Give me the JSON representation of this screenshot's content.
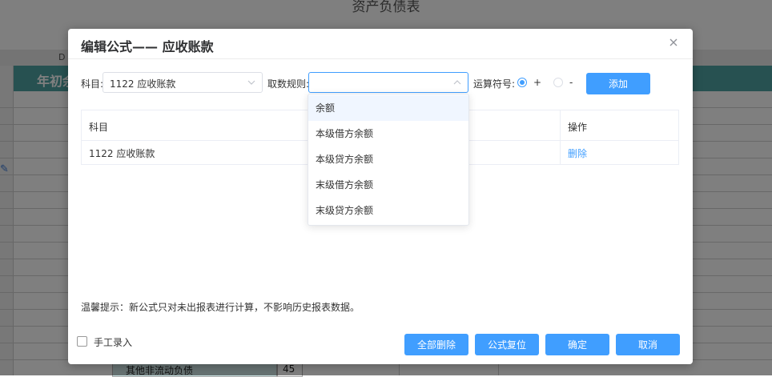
{
  "background": {
    "sheet_title": "资产负债表",
    "column_letter": "D",
    "header_text": "年初余",
    "bottom_row_label": "其他非流动负债",
    "bottom_row_number": "45"
  },
  "dialog": {
    "title": "编辑公式—— 应收账款",
    "subject_label": "科目:",
    "subject_value": "1122 应收账款",
    "rule_label": "取数规则:",
    "rule_value": "",
    "operator_label": "运算符号:",
    "operator_options": [
      {
        "label": "+",
        "checked": true
      },
      {
        "label": "-",
        "checked": false
      }
    ],
    "add_button": "添加",
    "table": {
      "columns": [
        "科目",
        "操作"
      ],
      "rows": [
        {
          "subject": "1122 应收账款",
          "action": "删除"
        }
      ]
    },
    "rule_dropdown": {
      "options": [
        "余额",
        "本级借方余额",
        "本级贷方余额",
        "末级借方余额",
        "末级贷方余额"
      ],
      "hovered_index": 0
    },
    "tip": "温馨提示：新公式只对未出报表进行计算，不影响历史报表数据。",
    "manual_entry_label": "手工录入",
    "manual_entry_checked": false,
    "footer_buttons": {
      "delete_all": "全部删除",
      "reset_formula": "公式复位",
      "confirm": "确定",
      "cancel": "取消"
    }
  },
  "colors": {
    "primary": "#409eff",
    "header_band": "#4fa3a3",
    "overlay": "rgba(0,0,0,0.5)"
  }
}
